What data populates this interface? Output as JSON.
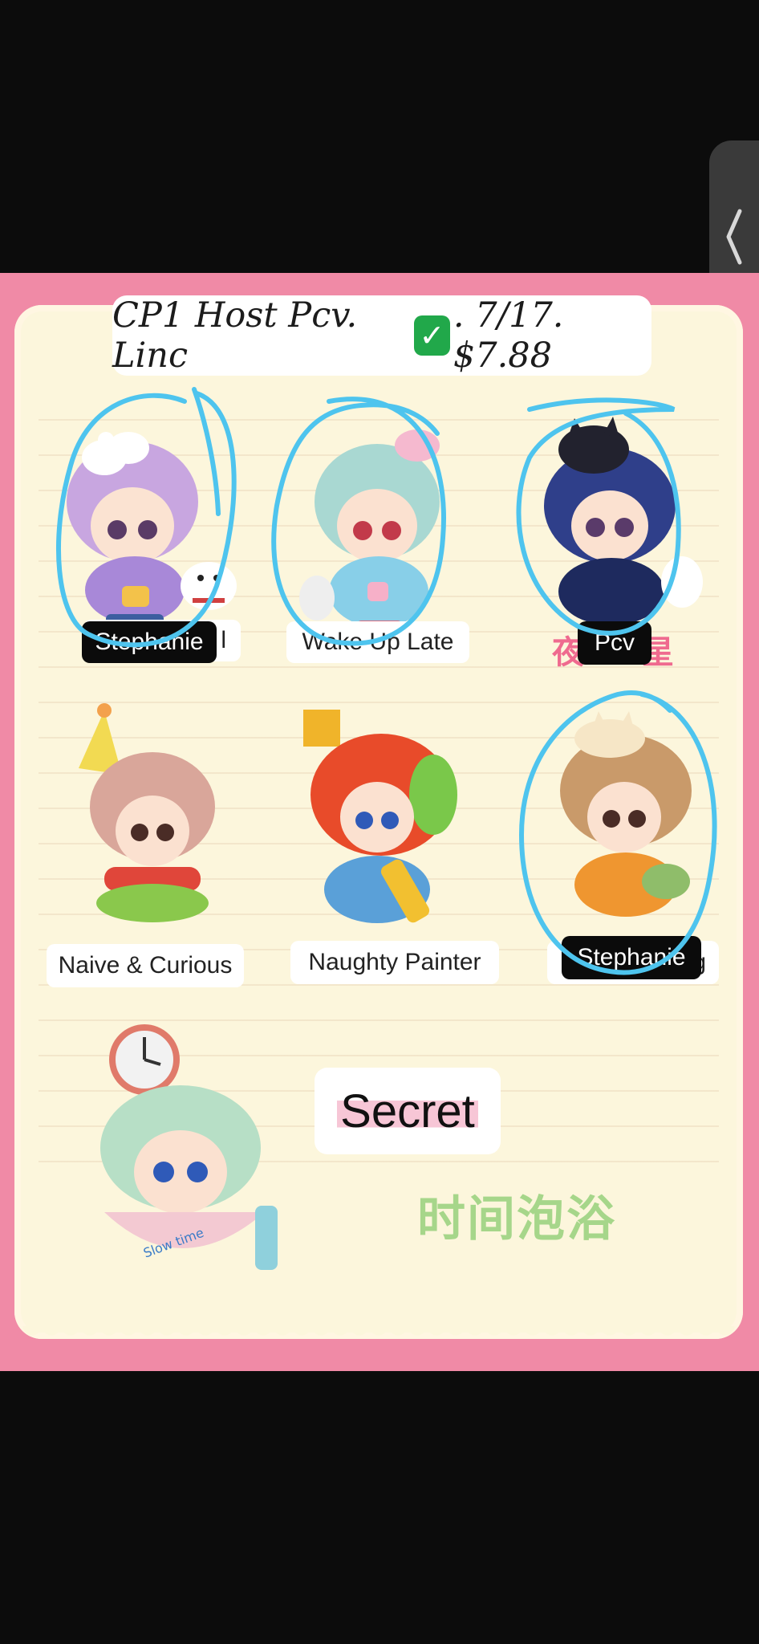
{
  "side_handle": {
    "icon": "chevron-left-icon"
  },
  "poster": {
    "title_prefix": "CP1 Host Pcv. Linc",
    "title_suffix": ". 7/17.  $7.88",
    "check_icon": "check-box-icon",
    "check_color": "#21a84a",
    "annotation_color": "#4ec4ee",
    "items": [
      {
        "label": "Stephanie",
        "label_under": "l",
        "tag": "Stephanie"
      },
      {
        "label": "Wake Up Late"
      },
      {
        "label_cn_left": "夜",
        "label_cn_right": "星",
        "tag": "Pcv"
      },
      {
        "label": "Naive & Curious"
      },
      {
        "label": "Naughty Painter"
      },
      {
        "label_under": "g",
        "tag": "Stephanie"
      }
    ],
    "secret_label": "Secret",
    "secret_cn": "时间泡浴",
    "bath_text": "Slow time"
  }
}
